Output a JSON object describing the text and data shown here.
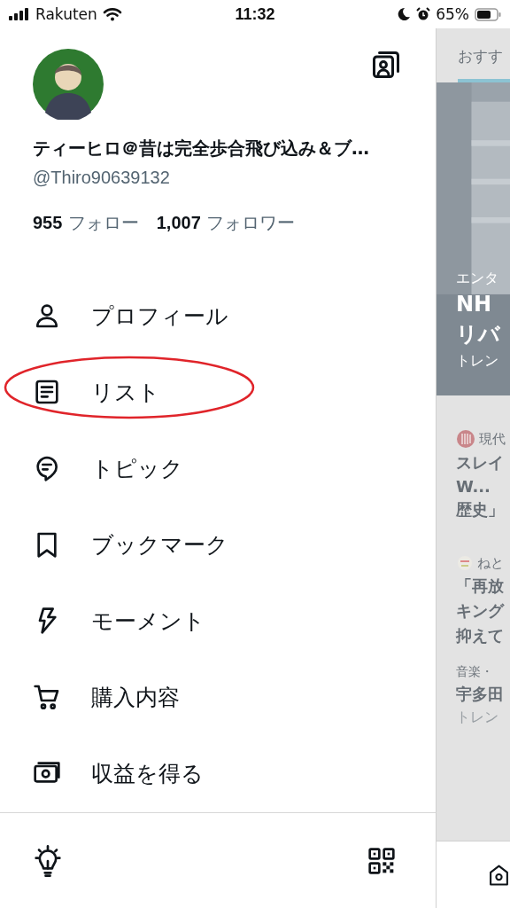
{
  "status_bar": {
    "carrier": "Rakuten",
    "time": "11:32",
    "battery": "65%"
  },
  "profile": {
    "name": "ティーヒロ＠昔は完全歩合飛び込み＆ブ…",
    "handle": "@Thiro90639132",
    "following_count": "955",
    "following_label": "フォロー",
    "followers_count": "1,007",
    "followers_label": "フォロワー"
  },
  "menu": [
    {
      "kind": "person",
      "label": "プロフィール",
      "circled": false
    },
    {
      "kind": "list",
      "label": "リスト",
      "circled": true
    },
    {
      "kind": "topic",
      "label": "トピック",
      "circled": false
    },
    {
      "kind": "bookmark",
      "label": "ブックマーク",
      "circled": false
    },
    {
      "kind": "bolt",
      "label": "モーメント",
      "circled": false
    },
    {
      "kind": "cart",
      "label": "購入内容",
      "circled": false
    },
    {
      "kind": "money",
      "label": "収益を得る",
      "circled": false
    }
  ],
  "feed": {
    "tab": "おすす",
    "hero": {
      "category": "エンタ",
      "title_lines": [
        "NH",
        "リバ"
      ],
      "meta": "トレン"
    },
    "items": [
      {
        "kind": "news",
        "source": "現代",
        "lines": [
          "スレイ",
          "W...",
          "歴史」"
        ]
      },
      {
        "kind": "news",
        "source": "ねと",
        "lines": [
          "「再放",
          "キング",
          "抑えて"
        ]
      },
      {
        "kind": "trend",
        "source": "音楽・",
        "lines": [
          "宇多田"
        ],
        "meta": "トレン"
      }
    ]
  }
}
